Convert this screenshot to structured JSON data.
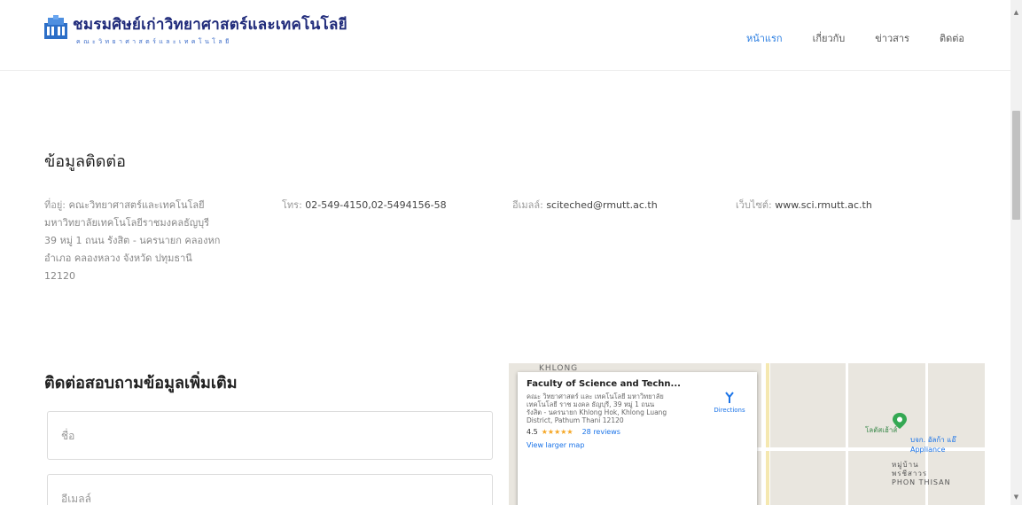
{
  "header": {
    "logo_title": "ชมรมศิษย์เก่าวิทยาศาสตร์และเทคโนโลยี",
    "logo_subtitle": "คณะวิทยาศาสตร์และเทคโนโลยี",
    "nav": [
      {
        "label": "หน้าแรก",
        "active": true
      },
      {
        "label": "เกี่ยวกับ",
        "active": false
      },
      {
        "label": "ข่าวสาร",
        "active": false
      },
      {
        "label": "ติดต่อ",
        "active": false
      }
    ]
  },
  "contact": {
    "title": "ข้อมูลติดต่อ",
    "address_label": "ที่อยู่:",
    "address_lines": [
      "คณะวิทยาศาสตร์และเทคโนโลยี",
      "มหาวิทยาลัยเทคโนโลยีราชมงคลธัญบุรี",
      "39 หมู่ 1 ถนน รังสิต - นครนายก คลองหก",
      "อำเภอ คลองหลวง จังหวัด ปทุมธานี",
      "12120"
    ],
    "tel_label": "โทร:",
    "tel_value": "02-549-4150,02-5494156-58",
    "email_label": "อีเมลล์:",
    "email_value": "sciteched@rmutt.ac.th",
    "web_label": "เว็บไซต์:",
    "web_value": "www.sci.rmutt.ac.th"
  },
  "form": {
    "title": "ติดต่อสอบถามข้อมูลเพิ่มเติม",
    "name_placeholder": "ชื่อ",
    "email_placeholder": "อีเมลล์"
  },
  "map": {
    "top_label": "KHLONG",
    "card_title": "Faculty of Science and Techn...",
    "card_address": "คณะ วิทยาศาสตร์ และ เทคโนโลยี มหาวิทยาลัย เทคโนโลยี ราช มงคล ธัญบุรี, 39 หมู่ 1 ถนน รังสิต - นครนายก Khlong Hok, Khlong Luang District, Pathum Thani 12120",
    "rating": "4.5",
    "stars": "★★★★★",
    "reviews": "28 reviews",
    "directions_label": "Directions",
    "larger_map": "View larger map",
    "place1": "โลตัสเฮ้าส์",
    "place2": "บจก. อัลก้า แอ๊ Appliance",
    "place3": "หมู่บ้าน\nพรชีสาวร\nPHON THISAN"
  },
  "colors": {
    "accent": "#2a7de1",
    "logo": "#1f2a7a",
    "star": "#f5a623"
  }
}
